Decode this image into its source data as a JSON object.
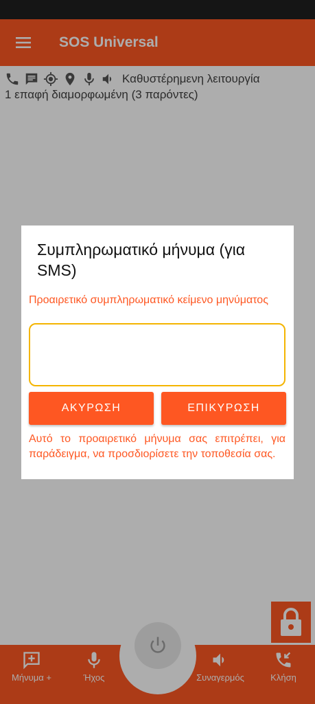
{
  "app": {
    "title": "SOS Universal",
    "accent_color": "#fe5722",
    "menu_icon": "menu-icon"
  },
  "status": {
    "icons": [
      "phone-icon",
      "message-icon",
      "gps-icon",
      "location-pin-icon",
      "microphone-icon",
      "speaker-icon"
    ],
    "mode_text": "Καθυστέρημενη λειτουργία",
    "contacts_text": "1 επαφή διαμορφωμένη (3 παρόντες)"
  },
  "dialog": {
    "title": "Συμπληρωματικό μήνυμα (για SMS)",
    "field_label": "Προαιρετικό συμπληρωματικό κείμενο μηνύματος",
    "field_value": "",
    "cancel_label": "ΑΚΥΡΩΣΗ",
    "confirm_label": "ΕΠΙΚΥΡΩΣΗ",
    "help_text": "Αυτό το προαιρετικό μήνυμα σας επιτρέπει, για παράδειγμα, να προσδιορίσετε την τοποθεσία σας."
  },
  "bottom_nav": {
    "items": [
      {
        "label": "Μήνυμα +",
        "icon": "add-message-icon"
      },
      {
        "label": "Ήχος",
        "icon": "microphone-icon"
      },
      {
        "label": "Συναγερμός",
        "icon": "speaker-icon"
      },
      {
        "label": "Κλήση",
        "icon": "call-icon"
      }
    ],
    "center_icon": "power-icon"
  },
  "lock_icon": "lock-icon"
}
